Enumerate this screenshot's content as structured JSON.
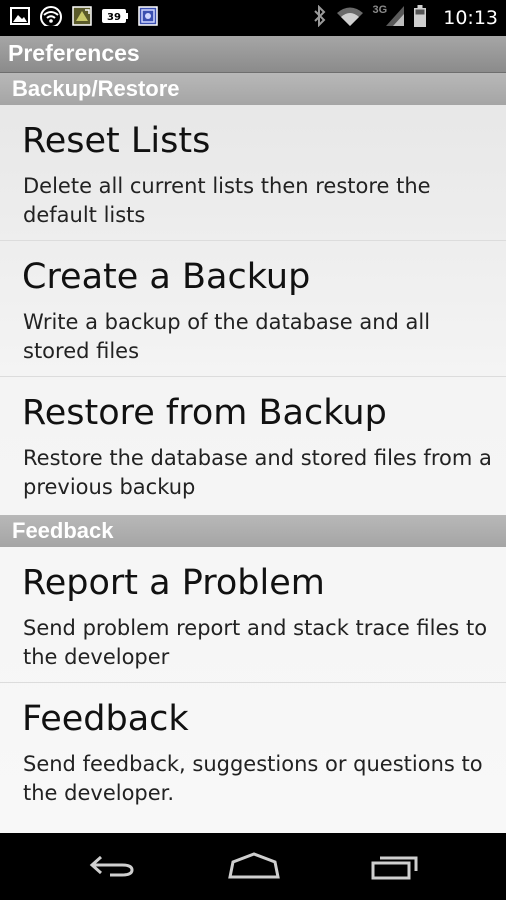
{
  "status_bar": {
    "time": "10:13",
    "network_type": "3G",
    "left_icons": [
      "image-icon",
      "wifi-icon",
      "notification-icon",
      "battery-level-icon",
      "app-icon"
    ],
    "right_icons": [
      "bluetooth-icon",
      "wifi-icon",
      "cell-signal-icon",
      "battery-icon"
    ]
  },
  "title_bar": {
    "title": "Preferences"
  },
  "sections": [
    {
      "header": "Backup/Restore",
      "items": [
        {
          "title": "Reset Lists",
          "summary": "Delete all current lists then restore the default lists"
        },
        {
          "title": "Create a Backup",
          "summary": "Write a backup of the database and all stored files"
        },
        {
          "title": "Restore from Backup",
          "summary": "Restore the database and stored files from a previous backup"
        }
      ]
    },
    {
      "header": "Feedback",
      "items": [
        {
          "title": "Report a Problem",
          "summary": "Send problem report and stack trace files to the developer"
        },
        {
          "title": "Feedback",
          "summary": "Send feedback, suggestions or questions to the developer."
        }
      ]
    }
  ],
  "nav_bar": {
    "buttons": [
      "back-icon",
      "home-icon",
      "recent-apps-icon"
    ]
  }
}
